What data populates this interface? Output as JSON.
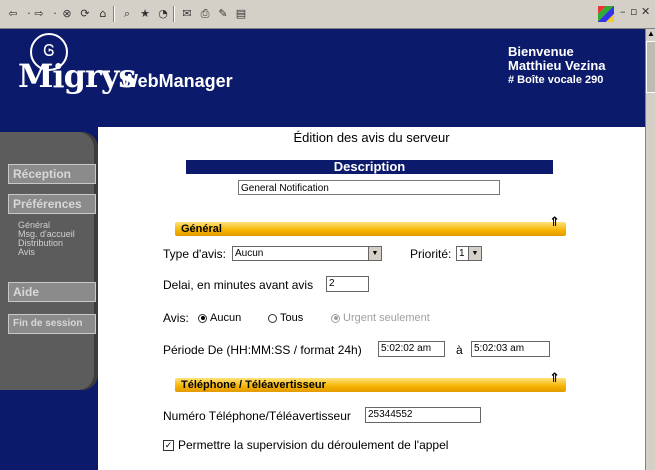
{
  "toolbar": {
    "icons": [
      "back-arrow",
      "forward-arrow",
      "stop",
      "refresh",
      "home",
      "search",
      "favorites",
      "history",
      "mail",
      "print",
      "edit",
      "discuss"
    ],
    "window_controls": [
      "minimize",
      "restore",
      "close"
    ]
  },
  "header": {
    "logo_glyph": "Ꮆ",
    "logo_text": "Migrys",
    "app_title": "WebManager",
    "welcome": "Bienvenue",
    "user_name": "Matthieu Vezina",
    "mailbox": "# Boîte vocale 290"
  },
  "nav": {
    "items": [
      {
        "label": "Réception"
      },
      {
        "label": "Préférences"
      },
      {
        "label": "Aide"
      },
      {
        "label": "Fin de session"
      }
    ],
    "subitems": [
      "Général",
      "Msg. d'accueil",
      "Distribution",
      "Avis"
    ]
  },
  "page": {
    "title": "Édition des avis du serveur",
    "description_label": "Description",
    "description_value": "General Notification"
  },
  "general": {
    "section_title": "Général",
    "type_label": "Type d'avis:",
    "type_value": "Aucun",
    "priority_label": "Priorité:",
    "priority_value": "1",
    "delay_label": "Delai, en minutes avant avis",
    "delay_value": "2",
    "avis_label": "Avis:",
    "radio_aucun": "Aucun",
    "radio_tous": "Tous",
    "radio_urgent": "Urgent seulement",
    "radio_selected": "Aucun",
    "period_label": "Période De (HH:MM:SS / format 24h)",
    "period_from": "5:02:02 am",
    "period_sep": "à",
    "period_to": "5:02:03 am"
  },
  "phone": {
    "section_title": "Téléphone / Téléavertisseur",
    "number_label": "Numéro Téléphone/Téléavertisseur",
    "number_value": "25344552",
    "supervision_label": "Permettre la supervision du déroulement de l'appel",
    "supervision_checked": true
  },
  "colors": {
    "header_bg": "#0b1a6b",
    "section_bar": "#f5b300",
    "nav_bg": "#5c5c5c"
  }
}
